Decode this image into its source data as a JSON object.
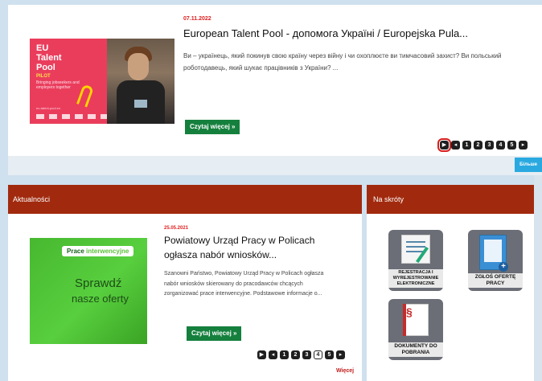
{
  "top_slider": {
    "date": "07.11.2022",
    "title": "European Talent Pool - допомога Україні / Europejska Pula...",
    "excerpt": "Ви – українець, який покинув свою країну через війну  і чи охоплюєте ви тимчасовий захист?   Ви польський роботодавець, який шукає працівників з України? ...",
    "button": "Czytaj więcej »",
    "image_text": {
      "eu_line1": "EU",
      "eu_line2": "Talent",
      "eu_line3": "Pool",
      "pilot": "PILOT",
      "tagline": "Bringing jobseekers and employers together",
      "url": "eu-talent-pool.eu"
    },
    "pager": {
      "play": "▶",
      "prev": "◂",
      "pages": [
        "1",
        "2",
        "3",
        "4",
        "5"
      ],
      "next": "▸"
    },
    "more_tab": "Більше"
  },
  "news": {
    "header": "Aktualności",
    "date": "25.05.2021",
    "title": "Powiatowy Urząd Pracy w Policach ogłasza nabór wniosków...",
    "excerpt": "Szanowni Państwo,   Powiatowy Urząd Pracy w Policach ogłasza nabór wniosków skierowany do pracodawców chcących zorganizować prace interwencyjne.   Podstawowe informacje o...",
    "button": "Czytaj więcej »",
    "image_text": {
      "tag_plain": "Prace ",
      "tag_accent": "interwencyjne",
      "line1": "Sprawdź",
      "line2": "nasze oferty"
    },
    "pager": {
      "play": "▶",
      "prev": "◂",
      "pages": [
        "1",
        "2",
        "3",
        "4",
        "5"
      ],
      "active_page": "4",
      "next": "▸"
    },
    "more_link": "Więcej"
  },
  "shortcuts": {
    "header": "Na skróty",
    "tiles": [
      {
        "label": "REJESTRACJA I WYREJESTROWANIE ELEKTRONICZNE",
        "icon": "registration-form-icon"
      },
      {
        "label": "ZGŁOŚ OFERTĘ PRACY",
        "icon": "job-offer-document-icon"
      },
      {
        "label": "DOKUMENTY DO POBRANIA",
        "icon": "documents-download-icon"
      }
    ]
  },
  "colors": {
    "header_bg": "#a12a0e",
    "button_green": "#15803d",
    "date_red": "#e02020",
    "accent_blue": "#2aa9e0",
    "page_bg": "#cfe0ee"
  }
}
